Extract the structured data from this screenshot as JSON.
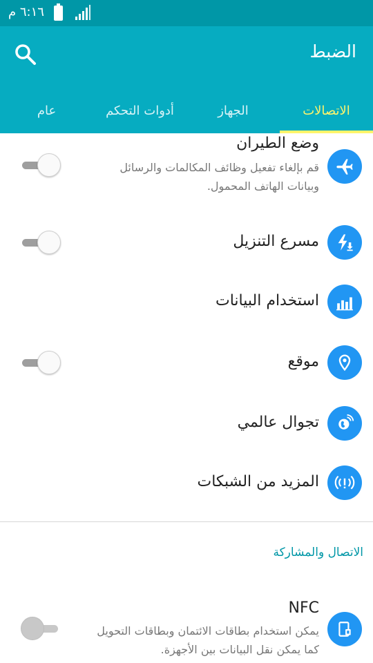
{
  "status_bar": {
    "time": "٦:١٦ م",
    "battery_icon": "battery-full-icon",
    "signal_icon": "signal-bars-icon"
  },
  "header": {
    "title": "الضبط",
    "search_icon": "search-icon"
  },
  "tabs": [
    {
      "label": "الاتصالات",
      "active": true
    },
    {
      "label": "الجهاز",
      "active": false
    },
    {
      "label": "أدوات التحكم",
      "active": false
    },
    {
      "label": "عام",
      "active": false
    }
  ],
  "settings": [
    {
      "title": "وضع الطيران",
      "subtitle": "قم بإلغاء تفعيل وظائف المكالمات والرسائل وبيانات الهاتف المحمول.",
      "icon": "airplane-icon",
      "toggle": "off"
    },
    {
      "title": "مسرع التنزيل",
      "icon": "download-booster-icon",
      "toggle": "off"
    },
    {
      "title": "استخدام البيانات",
      "icon": "bar-chart-icon"
    },
    {
      "title": "موقع",
      "icon": "location-pin-icon",
      "toggle": "off"
    },
    {
      "title": "تجوال عالمي",
      "icon": "globe-icon"
    },
    {
      "title": "المزيد من الشبكات",
      "icon": "antenna-icon"
    }
  ],
  "section_connect": {
    "header": "الاتصال والمشاركة",
    "items": [
      {
        "title": "NFC",
        "subtitle": "يمكن استخدام بطاقات الائتمان وبطاقات التحويل كما يمكن نقل البيانات بين الأجهزة.",
        "icon": "nfc-icon",
        "toggle": "disabled"
      }
    ]
  },
  "colors": {
    "status_bar": "#0097a7",
    "header": "#06acc1",
    "active_tab": "#fff46b",
    "icon_bg": "#2196f3",
    "section_header": "#0097a7"
  }
}
